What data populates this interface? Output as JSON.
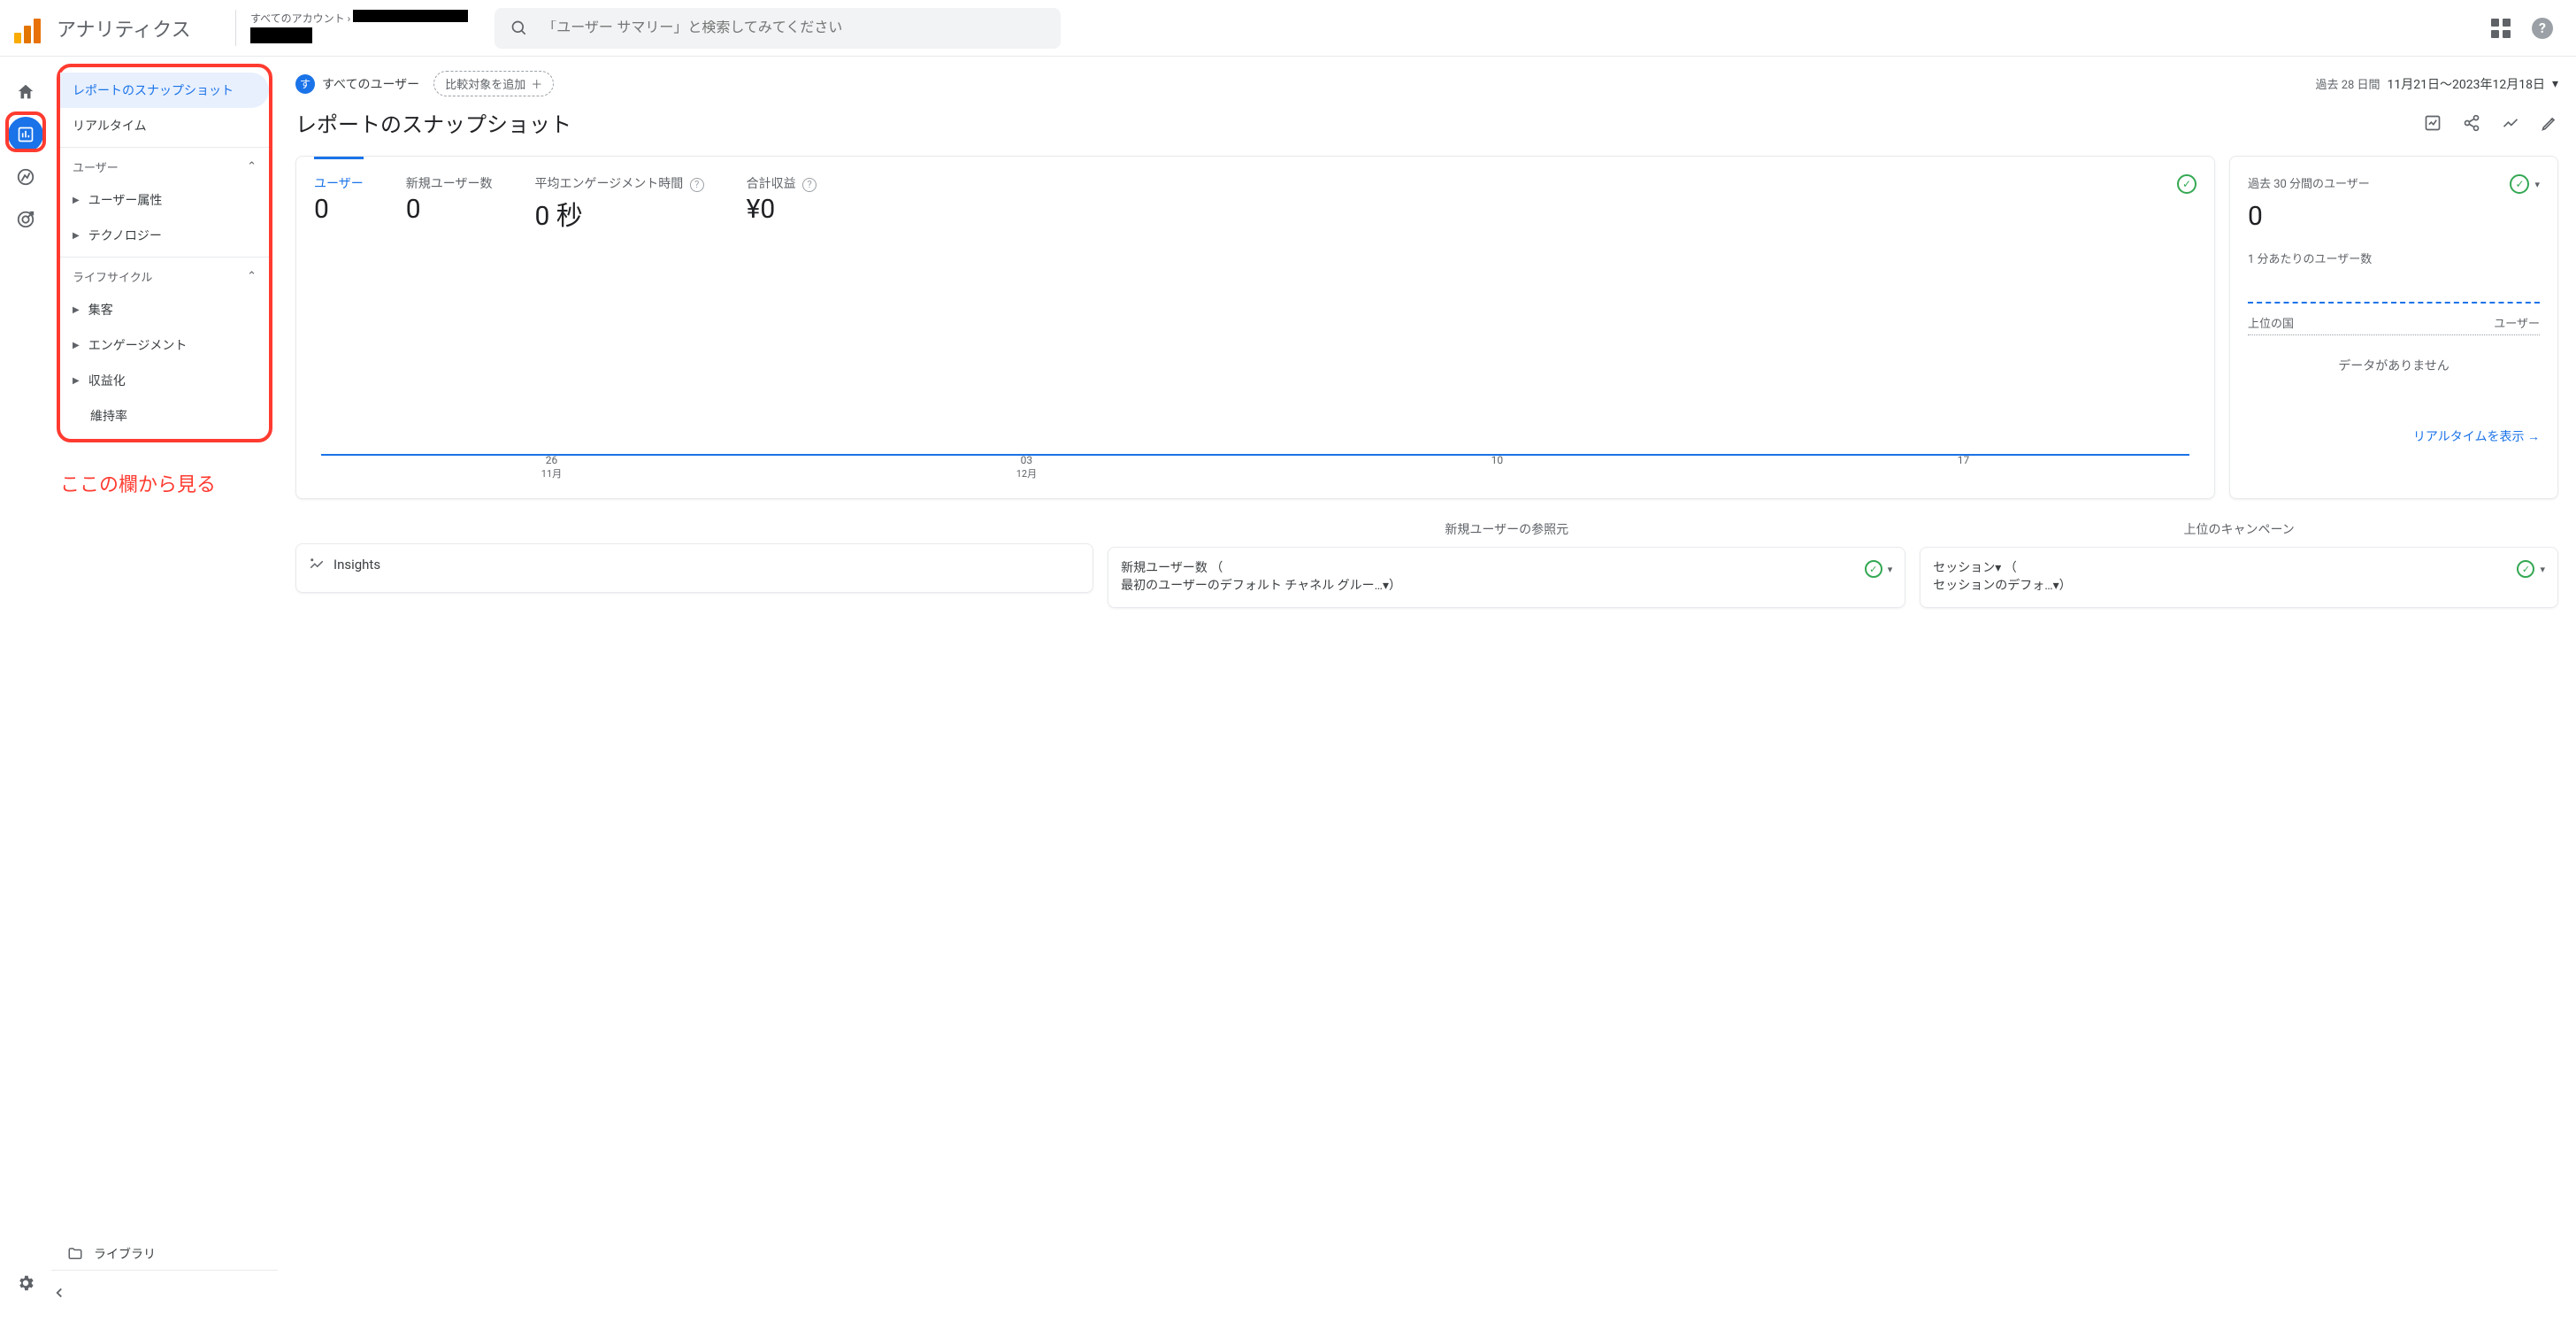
{
  "header": {
    "app_title": "アナリティクス",
    "account_label": "すべてのアカウント",
    "search_placeholder": "「ユーザー サマリー」と検索してみてください"
  },
  "sidebar": {
    "items": {
      "snapshot": "レポートのスナップショット",
      "realtime": "リアルタイム"
    },
    "section_user": "ユーザー",
    "user_items": {
      "attrs": "ユーザー属性",
      "tech": "テクノロジー"
    },
    "section_lifecycle": "ライフサイクル",
    "life_items": {
      "acq": "集客",
      "eng": "エンゲージメント",
      "mon": "収益化",
      "ret": "維持率"
    },
    "library": "ライブラリ"
  },
  "annotation": "ここの欄から見る",
  "topbar": {
    "all_users_badge": "す",
    "all_users": "すべてのユーザー",
    "add_compare": "比較対象を追加",
    "date_label": "過去 28 日間",
    "date_range": "11月21日～2023年12月18日"
  },
  "page_title": "レポートのスナップショット",
  "chart_data": {
    "type": "line",
    "metrics": [
      {
        "label": "ユーザー",
        "value": "0",
        "active": true
      },
      {
        "label": "新規ユーザー数",
        "value": "0"
      },
      {
        "label": "平均エンゲージメント時間",
        "value": "0 秒",
        "help": true
      },
      {
        "label": "合計収益",
        "value": "¥0",
        "help": true
      }
    ],
    "x_ticks": [
      {
        "top": "26",
        "sub": "11月"
      },
      {
        "top": "03",
        "sub": "12月"
      },
      {
        "top": "10",
        "sub": ""
      },
      {
        "top": "17",
        "sub": ""
      }
    ],
    "series": [
      {
        "name": "ユーザー",
        "values": [
          0,
          0,
          0,
          0
        ]
      }
    ]
  },
  "realtime_card": {
    "title": "過去 30 分間のユーザー",
    "value": "0",
    "per_min": "1 分あたりのユーザー数",
    "col1": "上位の国",
    "col2": "ユーザー",
    "no_data": "データがありません",
    "link": "リアルタイムを表示"
  },
  "bottom": {
    "insights": "Insights",
    "ref_label": "新規ユーザーの参照元",
    "ref_metric_l1": "新規ユーザー数 （",
    "ref_metric_l2": "最初のユーザーのデフォルト チャネル グルー…▾）",
    "camp_label": "上位のキャンペーン",
    "camp_metric_l1": "セッション▾ （",
    "camp_metric_l2": "セッションのデフォ…▾）"
  }
}
